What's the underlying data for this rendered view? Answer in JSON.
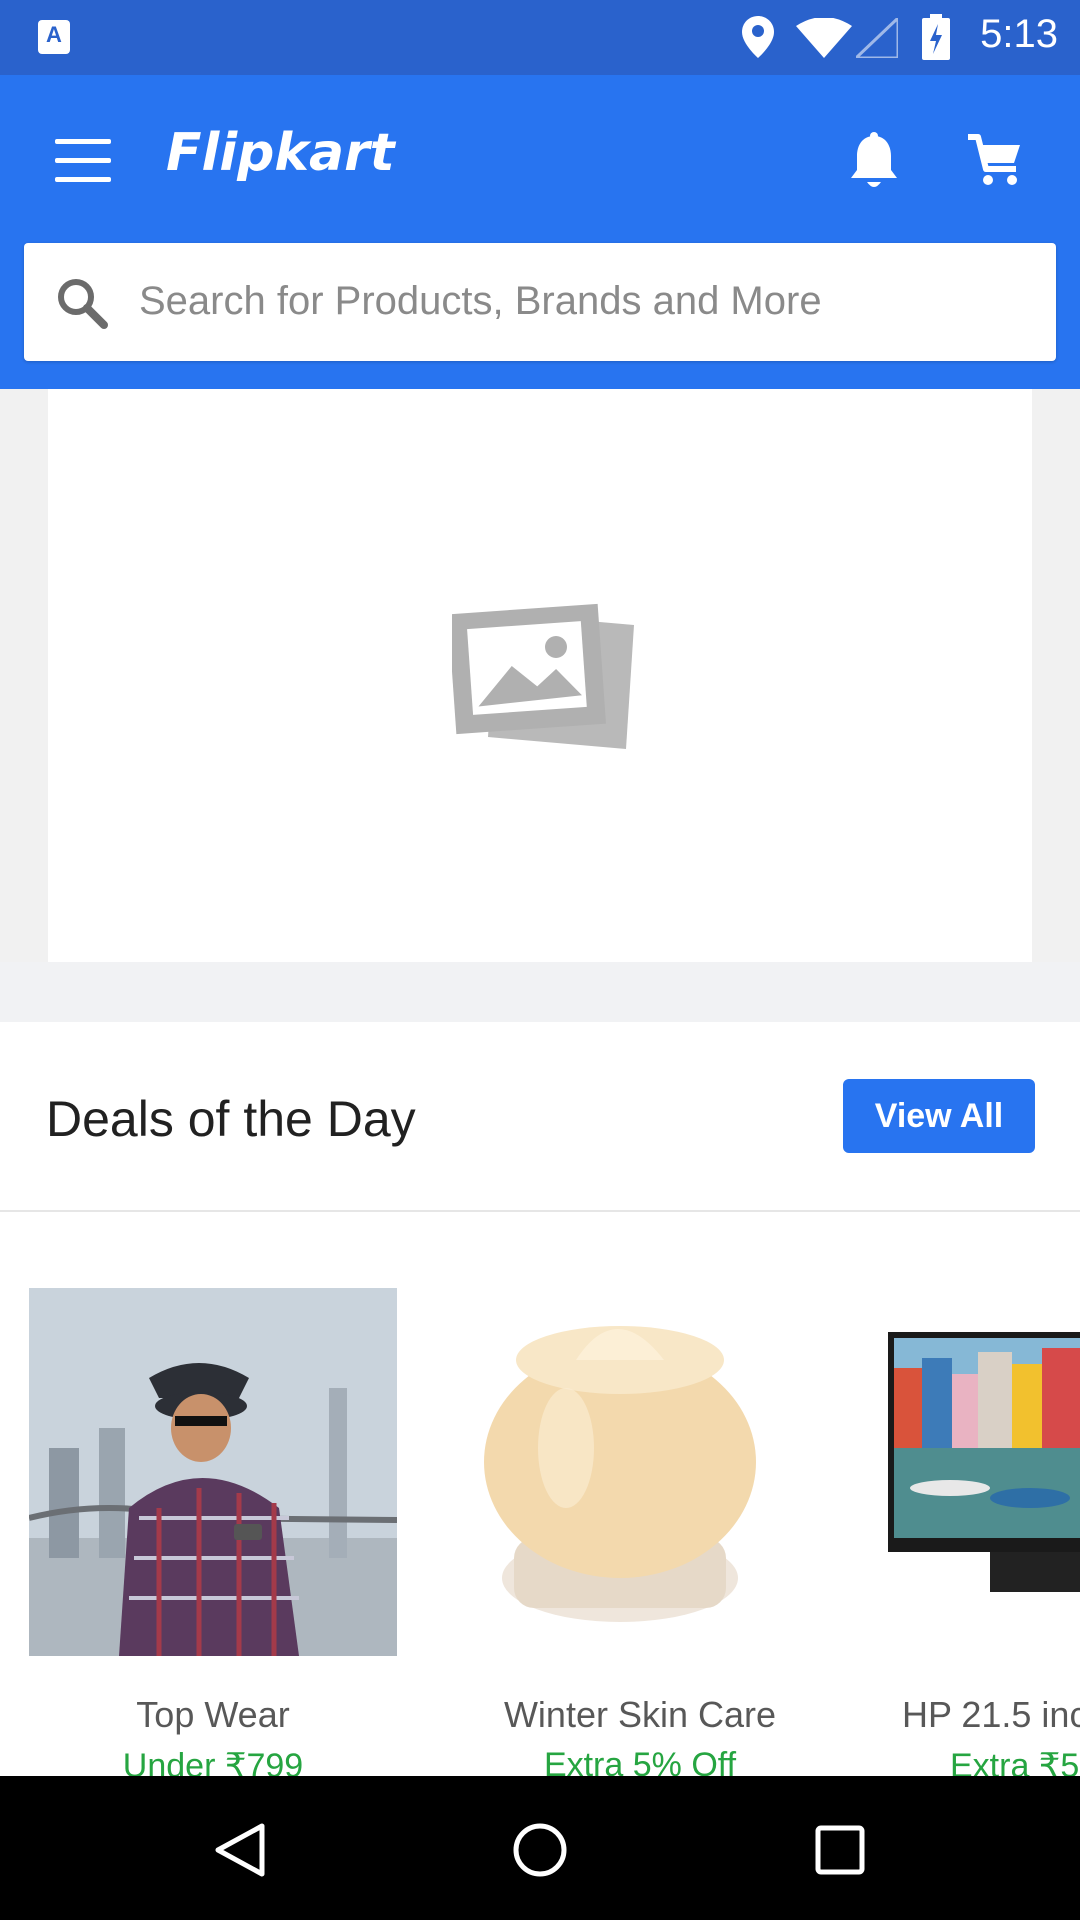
{
  "status_bar": {
    "time": "5:13",
    "app_icon_label": "A"
  },
  "app_bar": {
    "logo": "Flipkart",
    "icons": {
      "menu": "hamburger-menu-icon",
      "notifications": "bell-icon",
      "cart": "cart-icon"
    }
  },
  "search": {
    "placeholder": "Search for Products, Brands and More",
    "icon": "search-icon"
  },
  "banner": {
    "image_placeholder_icon": "image-placeholder-icon"
  },
  "deals": {
    "title": "Deals of the Day",
    "view_all_label": "View All",
    "items": [
      {
        "name": "Top Wear",
        "offer": "Under ₹799"
      },
      {
        "name": "Winter Skin Care",
        "offer": "Extra 5% Off"
      },
      {
        "name": "HP 21.5 inc",
        "offer": "Extra ₹5"
      }
    ]
  },
  "colors": {
    "brand_blue": "#2874f0",
    "status_bar": "#2a62cc",
    "offer_green": "#26a541",
    "button_blue": "#2874f0"
  },
  "nav_bar": {
    "icons": [
      "back-icon",
      "home-icon",
      "recents-icon"
    ]
  }
}
